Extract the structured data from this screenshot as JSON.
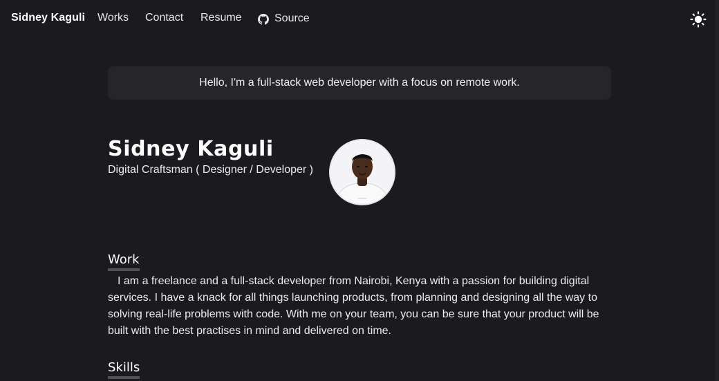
{
  "nav": {
    "brand": "Sidney Kaguli",
    "works": "Works",
    "contact": "Contact",
    "resume": "Resume",
    "source": "Source",
    "source_icon": "github-icon",
    "theme_icon": "sun-icon"
  },
  "banner": {
    "text": "Hello, I'm a full-stack web developer with a focus on remote work."
  },
  "hero": {
    "name": "Sidney Kaguli",
    "subtitle": "Digital Craftsman ( Designer / Developer )"
  },
  "work": {
    "title": "Work",
    "body": "I am a freelance and a full-stack developer from Nairobi, Kenya with a passion for building digital services. I have a knack for all things launching products, from planning and designing all the way to solving real-life problems with code. With me on your team, you can be sure that your product will be built with the best practises in mind and delivered on time."
  },
  "skills": {
    "title": "Skills"
  },
  "colors": {
    "background": "#1b1a1e",
    "banner": "#26252a",
    "underline": "#525059"
  }
}
